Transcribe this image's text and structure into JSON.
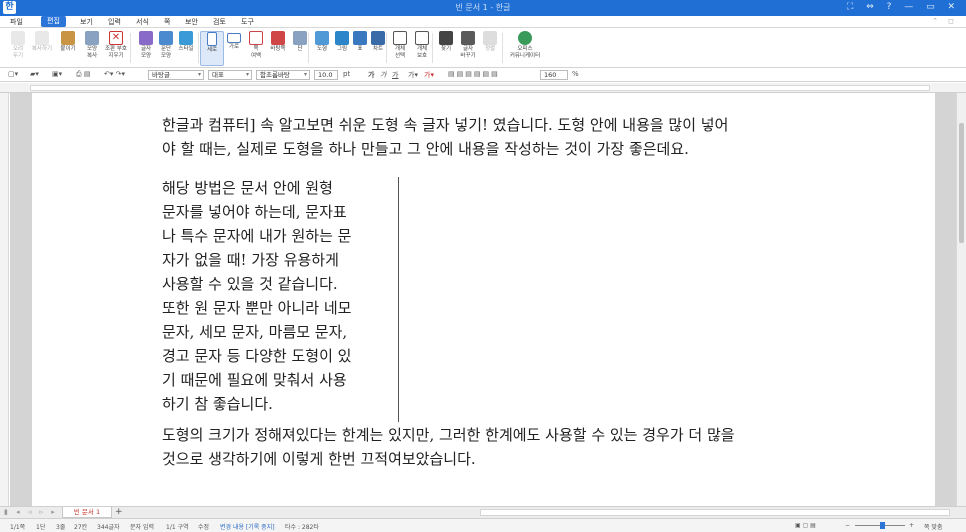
{
  "window": {
    "title": "빈 문서 1 - 한글",
    "controls": "⛶ ⇔ ? — ▭ ✕"
  },
  "menu": {
    "file": "파일",
    "items": [
      "편집",
      "보기",
      "입력",
      "서식",
      "쪽",
      "보안",
      "검토",
      "도구"
    ],
    "active_index": 0
  },
  "ribbon": {
    "buttons": [
      {
        "label": "오려\n두기",
        "icon": "scissors-icon",
        "dim": true
      },
      {
        "label": "복사하기",
        "icon": "copy-icon",
        "dim": true
      },
      {
        "label": "붙이기",
        "icon": "paste-icon"
      },
      {
        "label": "모양\n복사",
        "icon": "format-painter-icon"
      },
      {
        "label": "조판 부호\n지우기",
        "icon": "clear-format-icon"
      },
      {
        "label": "글자\n모양",
        "icon": "char-shape-icon"
      },
      {
        "label": "문단\n모양",
        "icon": "para-shape-icon"
      },
      {
        "label": "스타일",
        "icon": "style-icon"
      },
      {
        "label": "세로",
        "icon": "portrait-icon",
        "selected": true
      },
      {
        "label": "가로",
        "icon": "landscape-icon"
      },
      {
        "label": "쪽\n여백",
        "icon": "margin-icon"
      },
      {
        "label": "바탕쪽",
        "icon": "master-page-icon"
      },
      {
        "label": "단",
        "icon": "column-icon"
      },
      {
        "label": "도형",
        "icon": "shape-icon"
      },
      {
        "label": "그림",
        "icon": "picture-icon"
      },
      {
        "label": "표",
        "icon": "table-icon"
      },
      {
        "label": "차트",
        "icon": "chart-icon"
      },
      {
        "label": "개체\n선택",
        "icon": "select-object-icon"
      },
      {
        "label": "개체\n보호",
        "icon": "protect-object-icon"
      },
      {
        "label": "찾기",
        "icon": "find-icon"
      },
      {
        "label": "글자\n바꾸기",
        "icon": "replace-icon"
      },
      {
        "label": "정렬",
        "icon": "sort-icon",
        "dim": true
      },
      {
        "label": "오피스\n커뮤니케이터",
        "icon": "communicator-icon"
      }
    ]
  },
  "format": {
    "style": "바탕글",
    "lang": "대표",
    "font": "함초롬바탕",
    "size": "10.0",
    "unit": "pt",
    "zoom": "160",
    "zoom_unit": "%"
  },
  "document": {
    "p1": [
      "한글과 컴퓨터] 속 알고보면 쉬운 도형 속 글자 넣기! 였습니다. 도형 안에 내용을 많이 넣어",
      "야 할 때는, 실제로 도형을 하나 만들고 그 안에 내용을 작성하는 것이 가장 좋은데요."
    ],
    "box": [
      "해당 방법은 문서 안에 원형",
      "문자를 넣어야 하는데, 문자표",
      "나 특수 문자에 내가 원하는 문",
      "자가 없을 때! 가장 유용하게",
      "사용할 수 있을 것 같습니다.",
      "또한 원 문자 뿐만 아니라 네모",
      "문자, 세모 문자, 마름모 문자,",
      "경고 문자 등 다양한 도형이 있",
      "기 때문에 필요에 맞춰서 사용",
      "하기 참 좋습니다."
    ],
    "p3": [
      "도형의 크기가 정해져있다는 한계는 있지만, 그러한 한계에도 사용할 수 있는 경우가 더 많을",
      "것으로 생각하기에 이렇게 한번 끄적여보았습니다."
    ]
  },
  "tabs": {
    "doc_tab": "빈 문서 1",
    "add": "+"
  },
  "status": {
    "page": "1/1쪽",
    "section_col": "1단",
    "line": "3줄",
    "column": "27칸",
    "chars": "344글자",
    "mode": "문자 입력",
    "section": "1/1 구역",
    "edit": "수정",
    "track": "변경 내용 [기록 중지]",
    "typing": "타수 : 282타",
    "zoom": "쪽 맞춤"
  },
  "colors": {
    "accent": "#2b74d8",
    "titlebar": "#1f6fd4"
  }
}
